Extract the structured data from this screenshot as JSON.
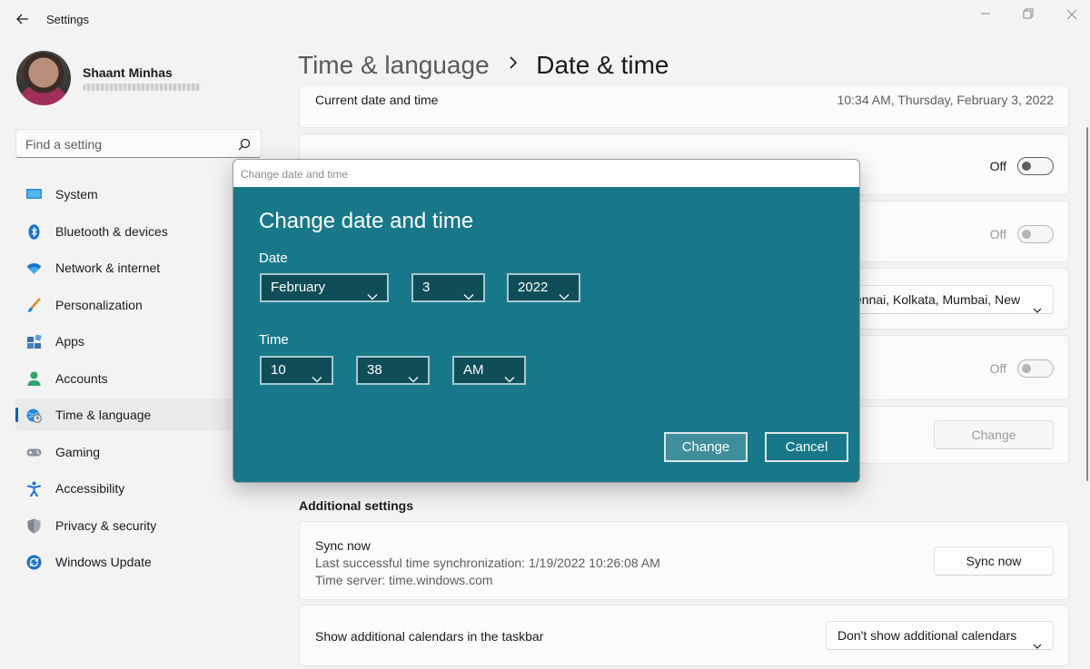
{
  "window": {
    "title": "Settings"
  },
  "user": {
    "name": "Shaant Minhas"
  },
  "search": {
    "placeholder": "Find a setting"
  },
  "sidebar": {
    "items": [
      {
        "label": "System",
        "icon": "monitor-icon"
      },
      {
        "label": "Bluetooth & devices",
        "icon": "bluetooth-icon"
      },
      {
        "label": "Network & internet",
        "icon": "wifi-icon"
      },
      {
        "label": "Personalization",
        "icon": "brush-icon"
      },
      {
        "label": "Apps",
        "icon": "apps-icon"
      },
      {
        "label": "Accounts",
        "icon": "person-icon"
      },
      {
        "label": "Time & language",
        "icon": "globe-clock-icon",
        "active": true
      },
      {
        "label": "Gaming",
        "icon": "gamepad-icon"
      },
      {
        "label": "Accessibility",
        "icon": "accessibility-icon"
      },
      {
        "label": "Privacy & security",
        "icon": "shield-icon"
      },
      {
        "label": "Windows Update",
        "icon": "update-icon"
      }
    ]
  },
  "breadcrumb": {
    "parent": "Time & language",
    "separator": ">",
    "current": "Date & time"
  },
  "main": {
    "current_datetime": {
      "label": "Current date and time",
      "value": "10:34 AM, Thursday, February 3, 2022"
    },
    "toggle1": {
      "state": "Off"
    },
    "toggle2": {
      "state": "Off"
    },
    "timezone": {
      "value": "ennai, Kolkata, Mumbai, New"
    },
    "toggle3": {
      "state": "Off"
    },
    "change_button": "Change",
    "additional_settings_title": "Additional settings",
    "sync": {
      "title": "Sync now",
      "last_sync": "Last successful time synchronization: 1/19/2022 10:26:08 AM",
      "server": "Time server: time.windows.com",
      "button": "Sync now"
    },
    "calendars": {
      "label": "Show additional calendars in the taskbar",
      "value": "Don't show additional calendars"
    }
  },
  "dialog": {
    "window_title": "Change date and time",
    "heading": "Change date and time",
    "date_label": "Date",
    "month": "February",
    "day": "3",
    "year": "2022",
    "time_label": "Time",
    "hour": "10",
    "minute": "38",
    "ampm": "AM",
    "change_button": "Change",
    "cancel_button": "Cancel"
  },
  "colors": {
    "dialog_bg": "#18788a",
    "accent": "#005fb8"
  }
}
